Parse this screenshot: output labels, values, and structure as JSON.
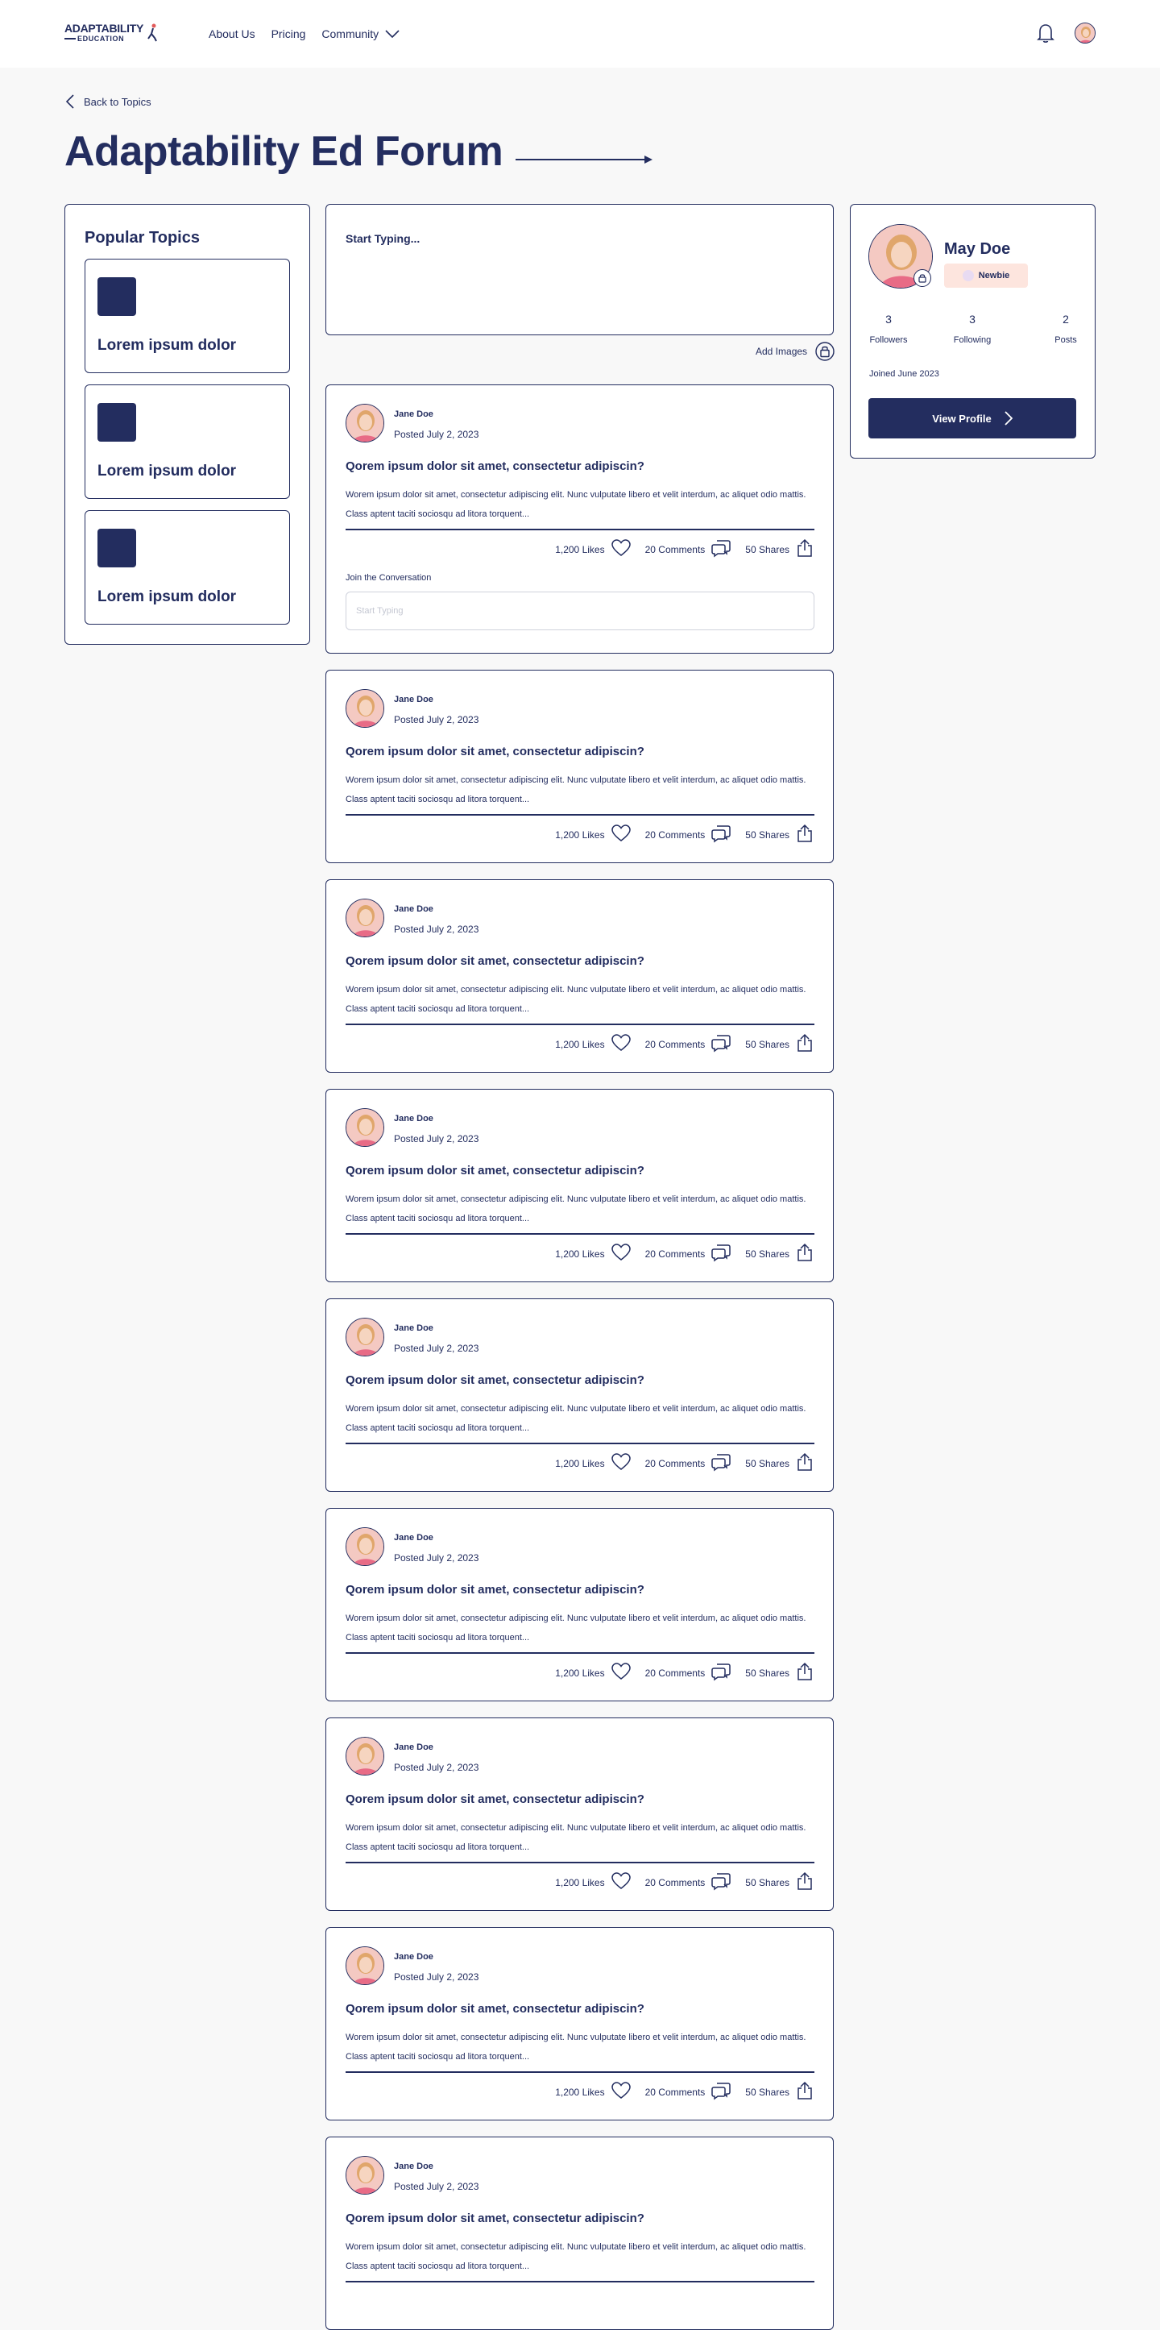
{
  "header": {
    "logo_top": "ADAPTABILITY",
    "logo_bottom": "EDUCATION",
    "nav": [
      {
        "label": "About Us"
      },
      {
        "label": "Pricing"
      },
      {
        "label": "Community"
      }
    ]
  },
  "page": {
    "back_label": "Back to Topics",
    "title": "Adaptability Ed Forum"
  },
  "topics": {
    "title": "Popular Topics",
    "items": [
      {
        "label": "Lorem ipsum dolor"
      },
      {
        "label": "Lorem ipsum dolor"
      },
      {
        "label": "Lorem ipsum dolor"
      }
    ]
  },
  "composer": {
    "placeholder": "Start Typing...",
    "add_images_label": "Add Images"
  },
  "posts": [
    {
      "author": "Jane Doe",
      "date": "Posted July 2, 2023",
      "title": "Qorem ipsum dolor sit amet, consectetur adipiscin?",
      "body": "Worem ipsum dolor sit amet, consectetur adipiscing elit. Nunc vulputate libero et velit interdum, ac aliquet odio mattis. Class aptent taciti sociosqu ad litora torquent...",
      "likes": "1,200 Likes",
      "comments": "20 Comments",
      "shares": "50 Shares",
      "join_label": "Join the Conversation",
      "reply_placeholder": "Start Typing"
    },
    {
      "author": "Jane Doe",
      "date": "Posted July 2, 2023",
      "title": "Qorem ipsum dolor sit amet, consectetur adipiscin?",
      "body": "Worem ipsum dolor sit amet, consectetur adipiscing elit. Nunc vulputate libero et velit interdum, ac aliquet odio mattis. Class aptent taciti sociosqu ad litora torquent...",
      "likes": "1,200 Likes",
      "comments": "20 Comments",
      "shares": "50 Shares"
    },
    {
      "author": "Jane Doe",
      "date": "Posted July 2, 2023",
      "title": "Qorem ipsum dolor sit amet, consectetur adipiscin?",
      "body": "Worem ipsum dolor sit amet, consectetur adipiscing elit. Nunc vulputate libero et velit interdum, ac aliquet odio mattis. Class aptent taciti sociosqu ad litora torquent...",
      "likes": "1,200 Likes",
      "comments": "20 Comments",
      "shares": "50 Shares"
    },
    {
      "author": "Jane Doe",
      "date": "Posted July 2, 2023",
      "title": "Qorem ipsum dolor sit amet, consectetur adipiscin?",
      "body": "Worem ipsum dolor sit amet, consectetur adipiscing elit. Nunc vulputate libero et velit interdum, ac aliquet odio mattis. Class aptent taciti sociosqu ad litora torquent...",
      "likes": "1,200 Likes",
      "comments": "20 Comments",
      "shares": "50 Shares"
    },
    {
      "author": "Jane Doe",
      "date": "Posted July 2, 2023",
      "title": "Qorem ipsum dolor sit amet, consectetur adipiscin?",
      "body": "Worem ipsum dolor sit amet, consectetur adipiscing elit. Nunc vulputate libero et velit interdum, ac aliquet odio mattis. Class aptent taciti sociosqu ad litora torquent...",
      "likes": "1,200 Likes",
      "comments": "20 Comments",
      "shares": "50 Shares"
    },
    {
      "author": "Jane Doe",
      "date": "Posted July 2, 2023",
      "title": "Qorem ipsum dolor sit amet, consectetur adipiscin?",
      "body": "Worem ipsum dolor sit amet, consectetur adipiscing elit. Nunc vulputate libero et velit interdum, ac aliquet odio mattis. Class aptent taciti sociosqu ad litora torquent...",
      "likes": "1,200 Likes",
      "comments": "20 Comments",
      "shares": "50 Shares"
    },
    {
      "author": "Jane Doe",
      "date": "Posted July 2, 2023",
      "title": "Qorem ipsum dolor sit amet, consectetur adipiscin?",
      "body": "Worem ipsum dolor sit amet, consectetur adipiscing elit. Nunc vulputate libero et velit interdum, ac aliquet odio mattis. Class aptent taciti sociosqu ad litora torquent...",
      "likes": "1,200 Likes",
      "comments": "20 Comments",
      "shares": "50 Shares"
    },
    {
      "author": "Jane Doe",
      "date": "Posted July 2, 2023",
      "title": "Qorem ipsum dolor sit amet, consectetur adipiscin?",
      "body": "Worem ipsum dolor sit amet, consectetur adipiscing elit. Nunc vulputate libero et velit interdum, ac aliquet odio mattis. Class aptent taciti sociosqu ad litora torquent...",
      "likes": "1,200 Likes",
      "comments": "20 Comments",
      "shares": "50 Shares"
    },
    {
      "author": "Jane Doe",
      "date": "Posted July 2, 2023",
      "title": "Qorem ipsum dolor sit amet, consectetur adipiscin?",
      "body": "Worem ipsum dolor sit amet, consectetur adipiscing elit. Nunc vulputate libero et velit interdum, ac aliquet odio mattis. Class aptent taciti sociosqu ad litora torquent..."
    }
  ],
  "profile": {
    "name": "May Doe",
    "badge": "Newbie",
    "stats": [
      {
        "num": "3",
        "label": "Followers"
      },
      {
        "num": "3",
        "label": "Following"
      },
      {
        "num": "2",
        "label": "Posts"
      }
    ],
    "joined": "Joined June 2023",
    "button_label": "View Profile"
  },
  "colors": {
    "primary": "#232d5f",
    "background": "#f8f8f8",
    "badge_bg": "#fde5de"
  },
  "icons": [
    "bell-icon",
    "avatar",
    "chevron-left-icon",
    "chevron-down-icon",
    "arrow-right-icon",
    "heart-icon",
    "comment-icon",
    "share-icon",
    "image-lock-icon",
    "chevron-right-icon"
  ]
}
